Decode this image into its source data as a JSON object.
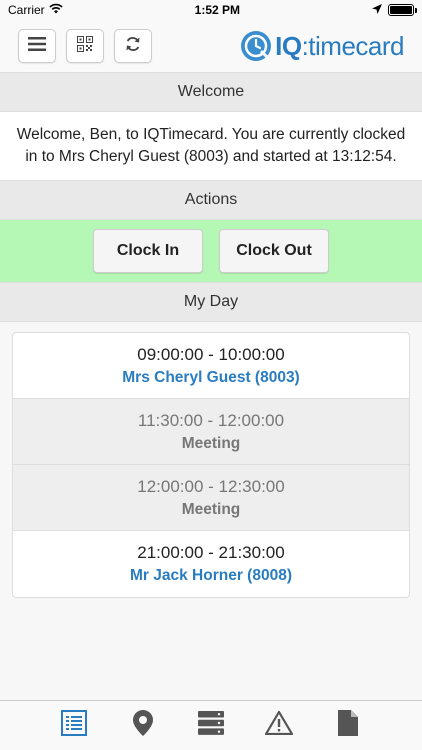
{
  "status_bar": {
    "carrier": "Carrier",
    "time": "1:52 PM",
    "wifi_icon": "wifi-icon",
    "location_icon": "location-arrow-icon",
    "battery_icon": "battery-icon"
  },
  "toolbar": {
    "menu_icon": "hamburger-menu-icon",
    "qr_icon": "qr-code-icon",
    "refresh_icon": "refresh-icon",
    "logo_prefix": "IQ",
    "logo_suffix": ":timecard"
  },
  "welcome": {
    "header": "Welcome",
    "message": "Welcome, Ben, to IQTimecard. You are currently clocked in to Mrs Cheryl Guest (8003) and started at 13:12:54."
  },
  "actions": {
    "header": "Actions",
    "clock_in_label": "Clock In",
    "clock_out_label": "Clock Out",
    "background_color": "#b5f7b5"
  },
  "my_day": {
    "header": "My Day",
    "items": [
      {
        "time": "09:00:00 - 10:00:00",
        "label": "Mrs Cheryl Guest (8003)",
        "style": "client"
      },
      {
        "time": "11:30:00 - 12:00:00",
        "label": "Meeting",
        "style": "meeting"
      },
      {
        "time": "12:00:00 - 12:30:00",
        "label": "Meeting",
        "style": "meeting"
      },
      {
        "time": "21:00:00 - 21:30:00",
        "label": "Mr Jack Horner (8008)",
        "style": "client"
      }
    ]
  },
  "tab_bar": {
    "tabs": [
      "list-icon",
      "map-marker-icon",
      "server-icon",
      "warning-icon",
      "document-icon"
    ],
    "accent_color": "#2a7cc0",
    "inactive_color": "#555555"
  }
}
